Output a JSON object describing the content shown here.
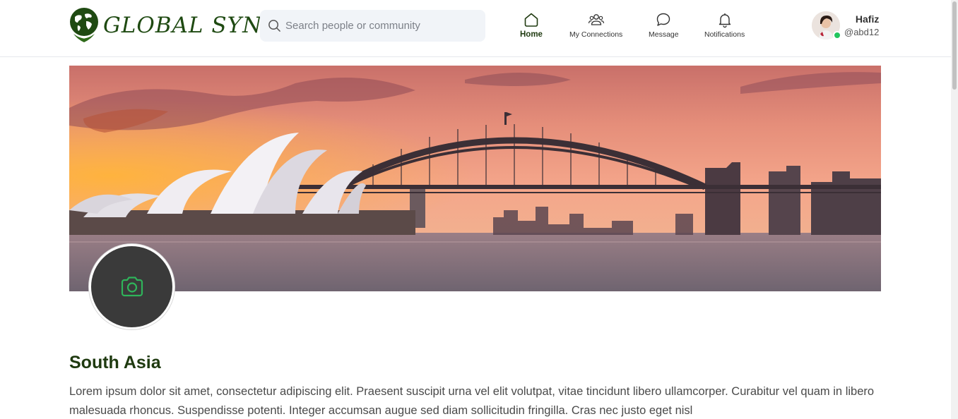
{
  "app": {
    "name": "GLOBAL SYNK",
    "accent": "#1f4a12"
  },
  "search": {
    "placeholder": "Search people or community",
    "value": ""
  },
  "nav": [
    {
      "label": "Home",
      "icon": "home-icon",
      "active": true
    },
    {
      "label": "My Connections",
      "icon": "users-icon",
      "active": false
    },
    {
      "label": "Message",
      "icon": "chat-icon",
      "active": false
    },
    {
      "label": "Notifications",
      "icon": "bell-icon",
      "active": false
    }
  ],
  "user": {
    "name": "Hafiz",
    "handle": "@abd12",
    "status_color": "#22c55e"
  },
  "community": {
    "name": "South Asia",
    "description": "Lorem ipsum dolor sit amet, consectetur adipiscing elit. Praesent suscipit urna vel elit volutpat, vitae tincidunt libero ullamcorper. Curabitur vel quam in libero malesuada rhoncus. Suspendisse potenti. Integer accumsan augue sed diam sollicitudin fringilla. Cras nec justo eget nisl",
    "photo_icon": "camera-icon"
  }
}
